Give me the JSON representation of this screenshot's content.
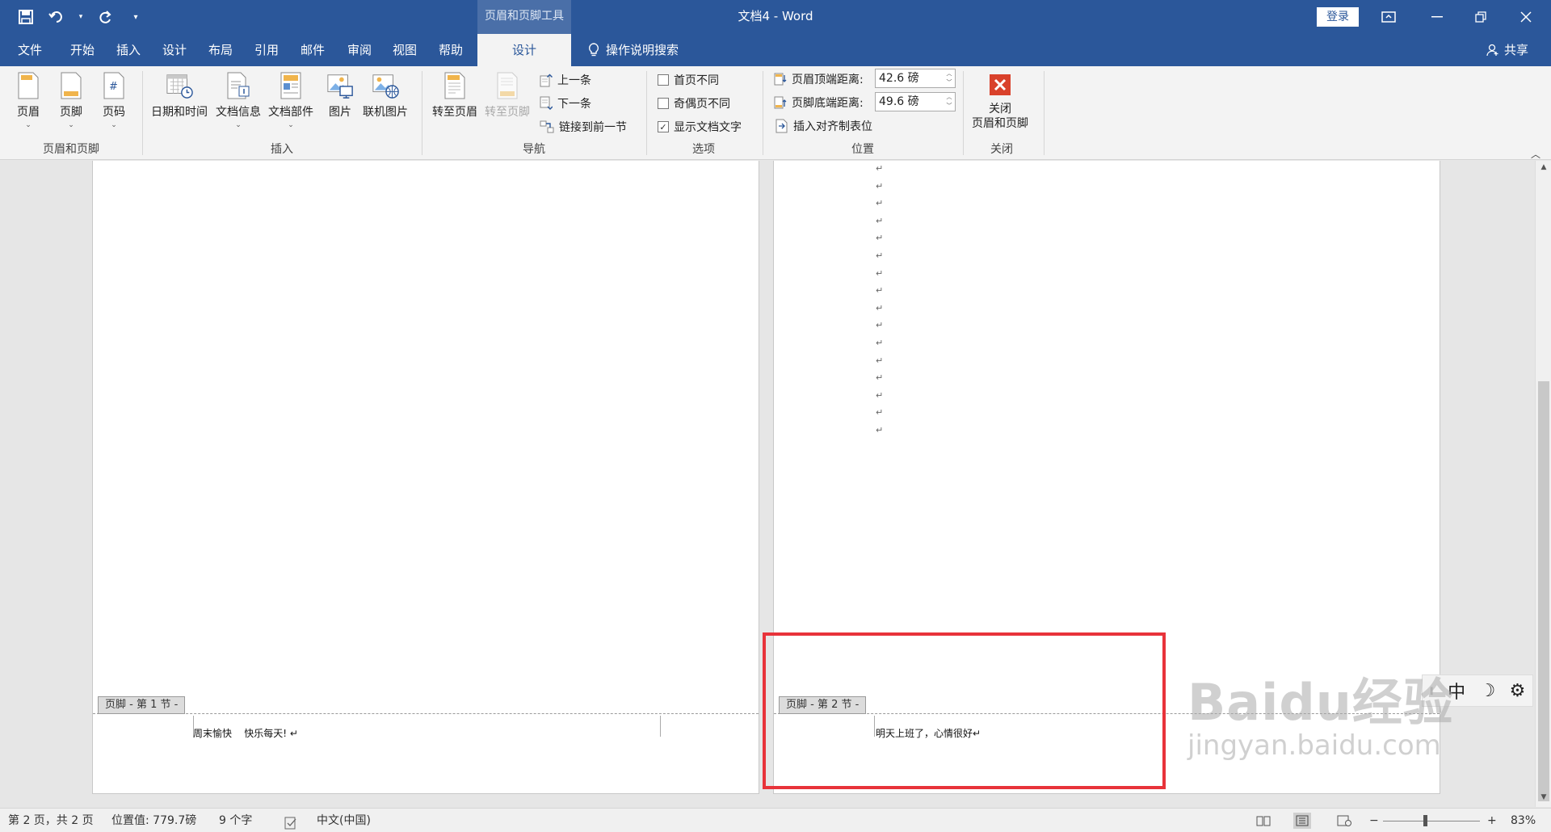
{
  "titlebar": {
    "context_tab_title": "页眉和页脚工具",
    "doc_title": "文档4  -  Word",
    "signin_label": "登录",
    "qat_icons": [
      "save-icon",
      "undo-icon",
      "redo-icon",
      "customize-icon"
    ]
  },
  "tabs": {
    "file": "文件",
    "home": "开始",
    "insert": "插入",
    "design": "设计",
    "layout": "布局",
    "references": "引用",
    "mailings": "邮件",
    "review": "审阅",
    "view": "视图",
    "help": "帮助",
    "hf_design": "设计",
    "tell_me": "操作说明搜索",
    "share": "共享"
  },
  "ribbon": {
    "hf_group": {
      "label": "页眉和页脚",
      "header": "页眉",
      "footer": "页脚",
      "page_number": "页码"
    },
    "insert_group": {
      "label": "插入",
      "date_time": "日期和时间",
      "doc_info": "文档信息",
      "quick_parts": "文档部件",
      "pictures": "图片",
      "online_pictures": "联机图片"
    },
    "nav_group": {
      "label": "导航",
      "goto_header": "转至页眉",
      "goto_footer": "转至页脚",
      "previous": "上一条",
      "next": "下一条",
      "link_previous": "链接到前一节"
    },
    "options_group": {
      "label": "选项",
      "diff_first": "首页不同",
      "diff_odd_even": "奇偶页不同",
      "show_doc_text": "显示文档文字",
      "diff_first_checked": false,
      "diff_odd_even_checked": false,
      "show_doc_text_checked": true
    },
    "position_group": {
      "label": "位置",
      "header_from_top_label": "页眉顶端距离:",
      "header_from_top_value": "42.6 磅",
      "footer_from_bottom_label": "页脚底端距离:",
      "footer_from_bottom_value": "49.6 磅",
      "insert_align_tab": "插入对齐制表位"
    },
    "close_group": {
      "label": "关闭",
      "close_line1": "关闭",
      "close_line2": "页眉和页脚"
    }
  },
  "document": {
    "paragraph_mark": "↵",
    "page1_footer_tag": "页脚 - 第 1 节 -",
    "page1_footer_text": "周末愉快    快乐每天! ↵",
    "page2_footer_tag": "页脚 - 第 2 节 -",
    "page2_footer_text": "明天上班了，心情很好↵"
  },
  "ime": {
    "mode": "中",
    "icons": [
      "moon-icon",
      "gear-icon"
    ]
  },
  "watermark": {
    "brand": "Baidu经验",
    "url": "jingyan.baidu.com"
  },
  "statusbar": {
    "page_info": "第 2 页，共 2 页",
    "position": "位置值: 779.7磅",
    "word_count": "9 个字",
    "language": "中文(中国)",
    "zoom_minus": "−",
    "zoom_plus": "+",
    "zoom_level": "83%"
  }
}
